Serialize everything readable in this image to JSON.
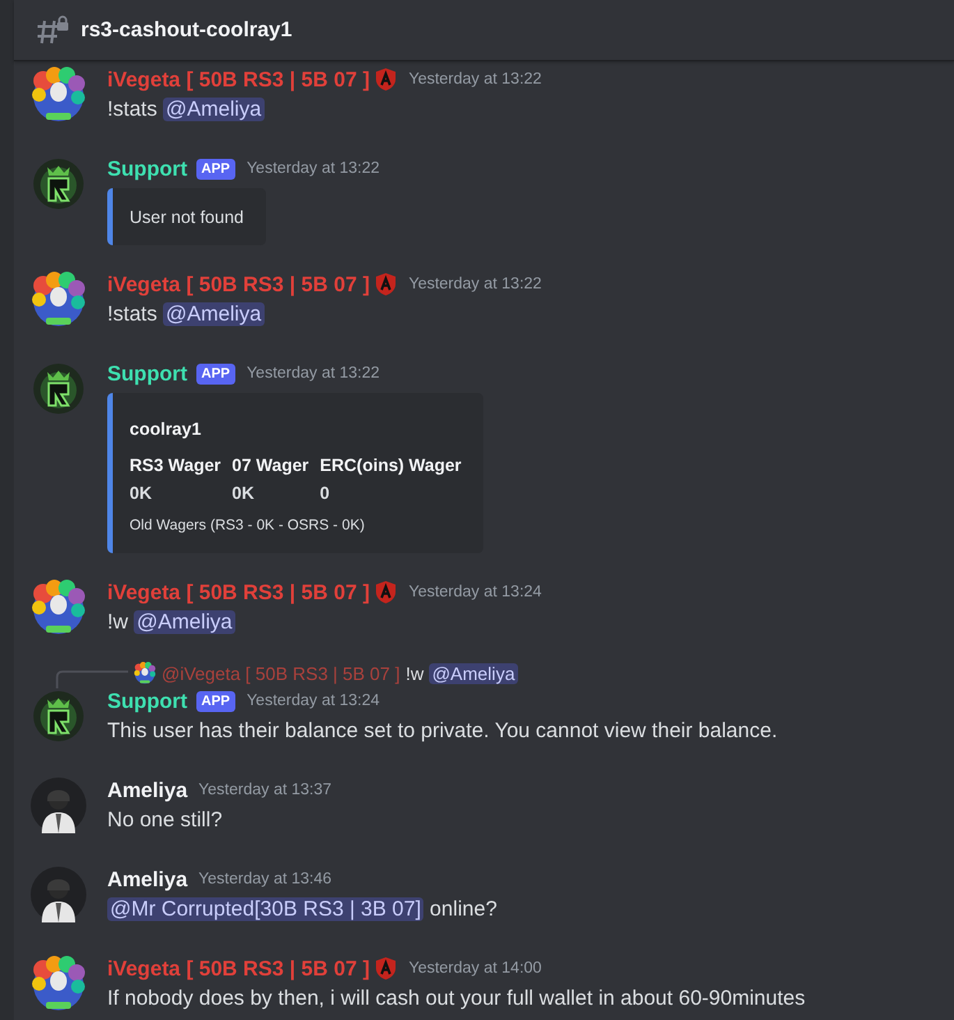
{
  "channel": {
    "name": "rs3-cashout-coolray1"
  },
  "messages": [
    {
      "kind": "rainbow",
      "author": "iVegeta [ 50B RS3 | 5B 07 ]",
      "color": "#e1403a",
      "role_badge": true,
      "time": "Yesterday at 13:22",
      "content": [
        {
          "kind": "text",
          "text": "!stats "
        },
        {
          "kind": "mention",
          "text": "@Ameliya"
        }
      ]
    },
    {
      "kind": "bot",
      "author": "Support",
      "color": "#3ee0b0",
      "role_badge": false,
      "app": "APP",
      "time": "Yesterday at 13:22",
      "embed": {
        "description": "User not found"
      }
    },
    {
      "kind": "rainbow",
      "author": "iVegeta [ 50B RS3 | 5B 07 ]",
      "color": "#e1403a",
      "role_badge": true,
      "time": "Yesterday at 13:22",
      "content": [
        {
          "kind": "text",
          "text": "!stats "
        },
        {
          "kind": "mention",
          "text": "@Ameliya"
        }
      ]
    },
    {
      "kind": "bot",
      "author": "Support",
      "color": "#3ee0b0",
      "role_badge": false,
      "app": "APP",
      "time": "Yesterday at 13:22",
      "embed": {
        "title": "coolray1",
        "fields": [
          {
            "name": "RS3 Wager",
            "value": "0K"
          },
          {
            "name": "07 Wager",
            "value": "0K"
          },
          {
            "name": "ERC(oins) Wager",
            "value": "0"
          }
        ],
        "footer": "Old Wagers (RS3 - 0K - OSRS - 0K)"
      }
    },
    {
      "kind": "rainbow",
      "author": "iVegeta [ 50B RS3 | 5B 07 ]",
      "color": "#e1403a",
      "role_badge": true,
      "time": "Yesterday at 13:24",
      "content": [
        {
          "kind": "text",
          "text": "!w "
        },
        {
          "kind": "mention",
          "text": "@Ameliya"
        }
      ]
    },
    {
      "kind": "bot",
      "author": "Support",
      "color": "#3ee0b0",
      "role_badge": false,
      "app": "APP",
      "time": "Yesterday at 13:24",
      "reply": {
        "author": "@iVegeta [ 50B RS3 | 5B 07 ]",
        "content": [
          {
            "kind": "text",
            "text": "!w "
          },
          {
            "kind": "mention",
            "text": "@Ameliya"
          }
        ]
      },
      "content": [
        {
          "kind": "text",
          "text": "This user has their balance set to private. You cannot view their balance."
        }
      ]
    },
    {
      "kind": "person",
      "author": "Ameliya",
      "color": "#f2f3f5",
      "role_badge": false,
      "time": "Yesterday at 13:37",
      "content": [
        {
          "kind": "text",
          "text": "No one still?"
        }
      ]
    },
    {
      "kind": "person",
      "author": "Ameliya",
      "color": "#f2f3f5",
      "role_badge": false,
      "time": "Yesterday at 13:46",
      "content": [
        {
          "kind": "mention",
          "text": "@Mr Corrupted[30B RS3 | 3B 07]"
        },
        {
          "kind": "text",
          "text": " online?"
        }
      ]
    },
    {
      "kind": "rainbow",
      "author": "iVegeta [ 50B RS3 | 5B 07 ]",
      "color": "#e1403a",
      "role_badge": true,
      "time": "Yesterday at 14:00",
      "content": [
        {
          "kind": "text",
          "text": "If nobody does by then, i will cash out your full wallet in about 60-90minutes"
        }
      ]
    }
  ]
}
